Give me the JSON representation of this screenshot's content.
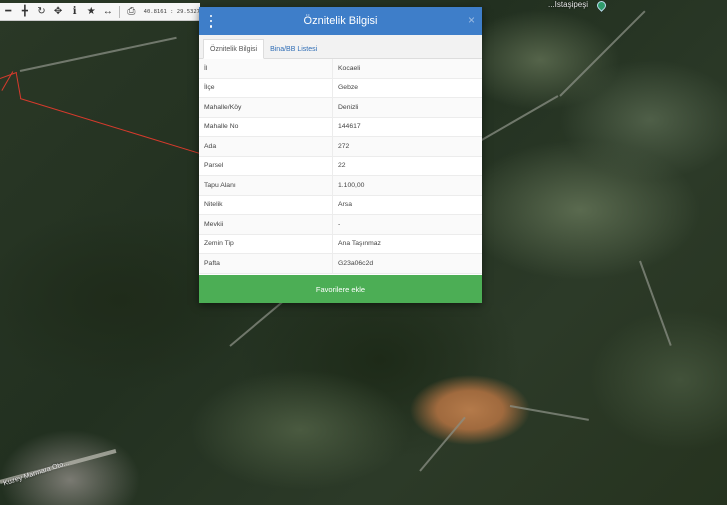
{
  "toolbar": {
    "icons": [
      "zoom-out",
      "zoom-in",
      "refresh",
      "locate",
      "info",
      "favorites",
      "measure",
      "print"
    ],
    "coordinates": "40.8161 : 29.5327"
  },
  "map": {
    "place_label": "...Istaşipeşi",
    "road_label": "Kuzey Marmara Oto..."
  },
  "dialog": {
    "title": "Öznitelik Bilgisi",
    "close_glyph": "×",
    "tabs": [
      {
        "label": "Öznitelik Bilgisi",
        "active": true
      },
      {
        "label": "Bina/BB Listesi",
        "active": false
      }
    ],
    "rows": [
      {
        "key": "İl",
        "value": "Kocaeli"
      },
      {
        "key": "İlçe",
        "value": "Gebze"
      },
      {
        "key": "Mahalle/Köy",
        "value": "Denizli"
      },
      {
        "key": "Mahalle No",
        "value": "144617"
      },
      {
        "key": "Ada",
        "value": "272"
      },
      {
        "key": "Parsel",
        "value": "22"
      },
      {
        "key": "Tapu Alanı",
        "value": "1.100,00"
      },
      {
        "key": "Nitelik",
        "value": "Arsa"
      },
      {
        "key": "Mevkii",
        "value": "-"
      },
      {
        "key": "Zemin Tip",
        "value": "Ana Taşınmaz"
      },
      {
        "key": "Pafta",
        "value": "G23a06c2d"
      }
    ],
    "favorite_button": "Favorilere ekle"
  },
  "colors": {
    "header": "#3e7ec9",
    "button": "#4cae55",
    "parcel_boundary": "#d63a2c"
  }
}
